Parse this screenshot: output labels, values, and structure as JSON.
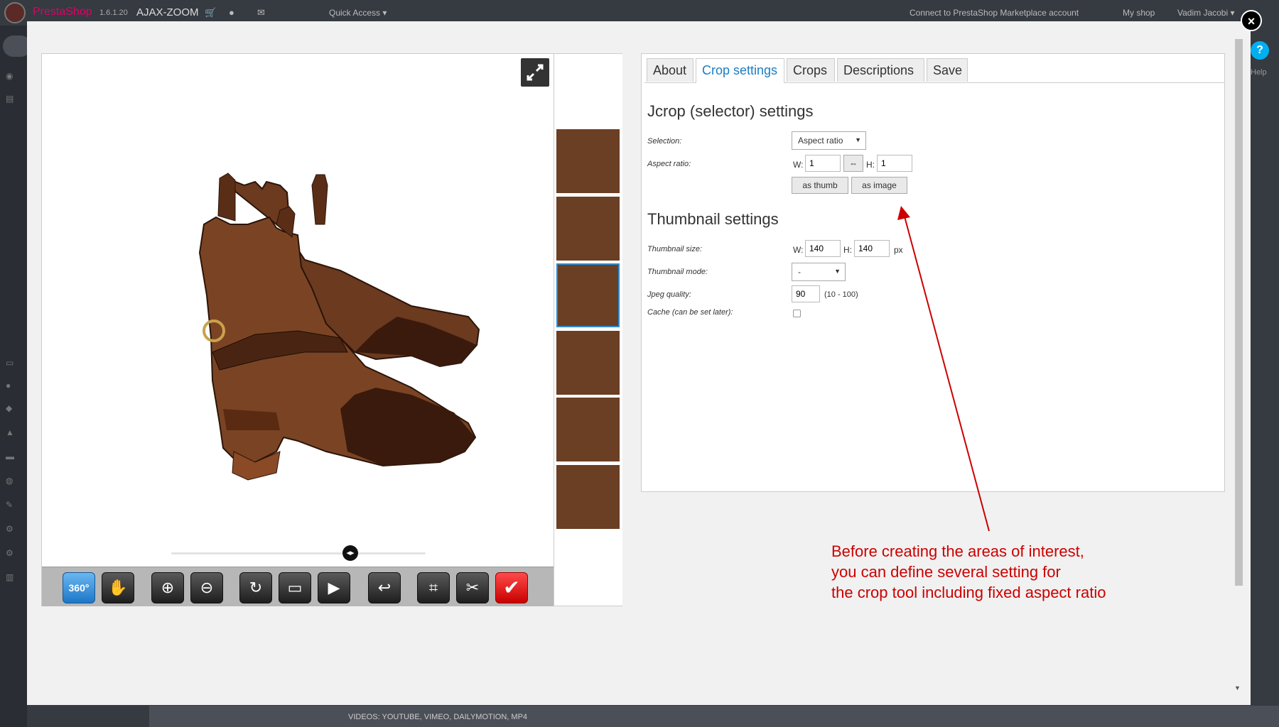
{
  "topbar": {
    "brand": "PrestaShop",
    "version": "1.6.1.20",
    "app": "AJAX-ZOOM",
    "quick_access": "Quick Access ▾",
    "marketplace": "Connect to PrestaShop Marketplace account",
    "my_shop": "My shop",
    "user": "Vadim Jacobi ▾"
  },
  "background": {
    "help_label": "Help",
    "bottom_label": "VIDEOS: YOUTUBE, VIMEO, DAILYMOTION, MP4"
  },
  "modal": {
    "close_label": "×"
  },
  "toolbar": {
    "spin_label": "360°",
    "buttons": [
      "360-spin",
      "pan",
      "zoom-in",
      "zoom-out",
      "reset",
      "fullscreen",
      "play",
      "undo",
      "crop",
      "tools",
      "confirm"
    ]
  },
  "tabs": [
    {
      "label": "About"
    },
    {
      "label": "Crop settings"
    },
    {
      "label": "Crops"
    },
    {
      "label": "Descriptions"
    },
    {
      "label": "Save"
    }
  ],
  "jcrop": {
    "title": "Jcrop (selector) settings",
    "selection_label": "Selection:",
    "selection_value": "Aspect ratio",
    "aspect_label": "Aspect ratio:",
    "w_label": "W:",
    "w_value": "1",
    "swap_label": "⇔",
    "h_label": "H:",
    "h_value": "1",
    "as_thumb": "as thumb",
    "as_image": "as image"
  },
  "thumbnail": {
    "title": "Thumbnail settings",
    "size_label": "Thumbnail size:",
    "w_label": "W:",
    "w_value": "140",
    "h_label": "H:",
    "h_value": "140",
    "unit": "px",
    "mode_label": "Thumbnail mode:",
    "mode_value": "-",
    "jpeg_label": "Jpeg quality:",
    "jpeg_value": "90",
    "jpeg_range": "(10 - 100)",
    "cache_label": "Cache (can be set later):"
  },
  "annotation": {
    "line1": "Before creating the areas of interest,",
    "line2": "you can define several setting for",
    "line3": "the crop tool including fixed aspect ratio"
  },
  "colors": {
    "annotation": "#cc0000",
    "active_tab": "#1b7dc4",
    "selected_thumb": "#2c8cd6"
  }
}
